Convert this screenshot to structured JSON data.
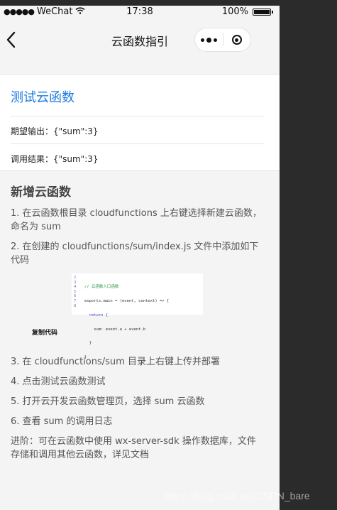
{
  "status_bar": {
    "carrier": "WeChat",
    "time": "17:38",
    "battery": "100%"
  },
  "nav": {
    "title": "云函数指引"
  },
  "test_card": {
    "title": "测试云函数",
    "expected_label": "期望输出：",
    "expected_value": "{\"sum\":3}",
    "result_label": "调用结果：",
    "result_value": "{\"sum\":3}"
  },
  "guide": {
    "heading": "新增云函数",
    "step1": "1. 在云函数根目录 cloudfunctions 上右键选择新建云函数，命名为 sum",
    "step2": "2. 在创建的 cloudfunctions/sum/index.js 文件中添加如下代码",
    "code_lines": [
      "// 云函数入口函数",
      "exports.main = (event, context) => {",
      "  return {",
      "    sum: event.a + event.b",
      "  }",
      "}"
    ],
    "code_line_numbers": [
      "2",
      "3",
      "4",
      "5",
      "6",
      "7",
      "8"
    ],
    "copy_label": "复制代码",
    "step3": "3. 在 cloudfunctions/sum 目录上右键上传并部署",
    "step4": "4. 点击测试云函数测试",
    "step5": "5. 打开云开发云函数管理页，选择 sum 云函数",
    "step6": "6. 查看 sum 的调用日志",
    "advanced": "进阶：可在云函数中使用 wx-server-sdk 操作数据库，文件存储和调用其他云函数，详见文档"
  },
  "watermark": "https://blog.csdn.net/CSDN_bare",
  "colors": {
    "link": "#1a7be0",
    "background": "#f4f4f4",
    "frame": "#2b2b2b"
  }
}
